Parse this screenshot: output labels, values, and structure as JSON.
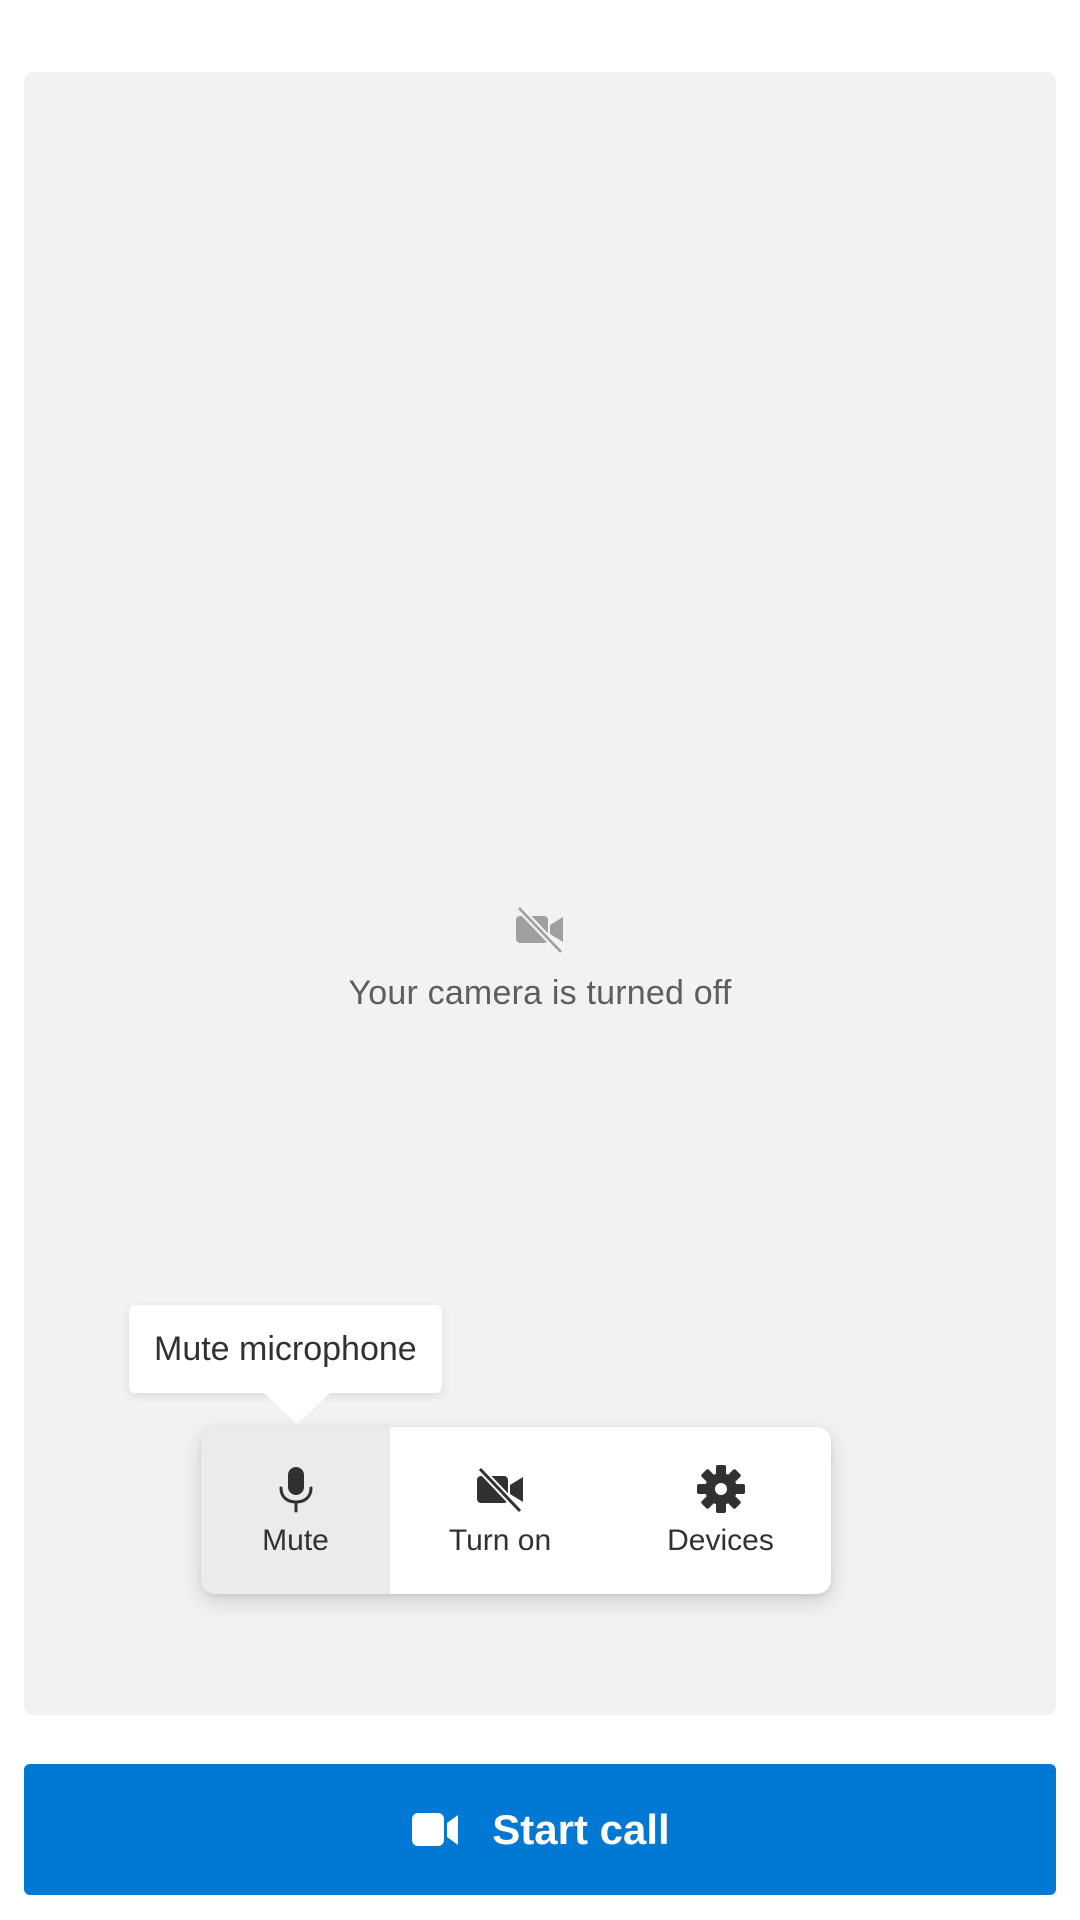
{
  "preview": {
    "camera_off_icon": "video-off-icon",
    "camera_off_text": "Your camera is turned off"
  },
  "tooltip": {
    "text": "Mute microphone"
  },
  "controls": {
    "mute": {
      "label": "Mute",
      "icon": "microphone-icon",
      "active": true
    },
    "camera": {
      "label": "Turn on",
      "icon": "video-off-icon"
    },
    "devices": {
      "label": "Devices",
      "icon": "gear-icon"
    }
  },
  "start_call": {
    "label": "Start call",
    "icon": "video-camera-icon"
  },
  "colors": {
    "accent": "#0078d4",
    "preview_bg": "#f3f2f1",
    "control_active_bg": "#edebe9",
    "text_primary": "#323130",
    "text_secondary": "#605e5c"
  }
}
